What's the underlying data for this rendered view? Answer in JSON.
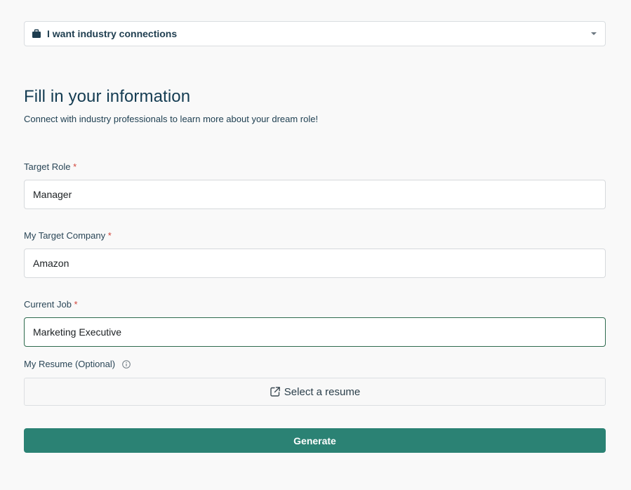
{
  "goal_select": {
    "value": "I want industry connections",
    "icon": "briefcase-icon"
  },
  "form": {
    "title": "Fill in your information",
    "subtitle": "Connect with industry professionals to learn more about your dream role!",
    "required_marker": "*",
    "target_role": {
      "label": "Target Role",
      "value": "Manager"
    },
    "target_company": {
      "label": "My Target Company",
      "value": "Amazon"
    },
    "current_job": {
      "label": "Current Job",
      "value": "Marketing Executive"
    },
    "resume": {
      "label": "My Resume (Optional)",
      "button_label": "Select a resume",
      "icon": "external-link-icon"
    },
    "generate_label": "Generate"
  },
  "colors": {
    "accent": "#2b8274",
    "heading": "#143c52",
    "required": "#d2453b",
    "focus_border": "#2e6b4e"
  }
}
